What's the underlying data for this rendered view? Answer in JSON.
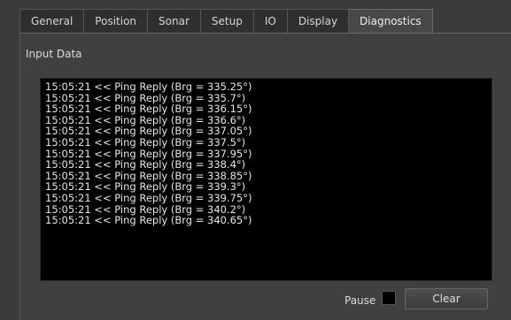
{
  "tabs": [
    {
      "label": "General"
    },
    {
      "label": "Position"
    },
    {
      "label": "Sonar"
    },
    {
      "label": "Setup"
    },
    {
      "label": "IO"
    },
    {
      "label": "Display"
    },
    {
      "label": "Diagnostics"
    }
  ],
  "active_tab": "Diagnostics",
  "panel": {
    "group_label": "Input Data",
    "log_lines": [
      "15:05:21 << Ping Reply (Brg = 335.25°)",
      "15:05:21 << Ping Reply (Brg = 335.7°)",
      "15:05:21 << Ping Reply (Brg = 336.15°)",
      "15:05:21 << Ping Reply (Brg = 336.6°)",
      "15:05:21 << Ping Reply (Brg = 337.05°)",
      "15:05:21 << Ping Reply (Brg = 337.5°)",
      "15:05:21 << Ping Reply (Brg = 337.95°)",
      "15:05:21 << Ping Reply (Brg = 338.4°)",
      "15:05:21 << Ping Reply (Brg = 338.85°)",
      "15:05:21 << Ping Reply (Brg = 339.3°)",
      "15:05:21 << Ping Reply (Brg = 339.75°)",
      "15:05:21 << Ping Reply (Brg = 340.2°)",
      "15:05:21 << Ping Reply (Brg = 340.65°)"
    ],
    "pause_label": "Pause",
    "pause_checked": false,
    "clear_label": "Clear"
  }
}
